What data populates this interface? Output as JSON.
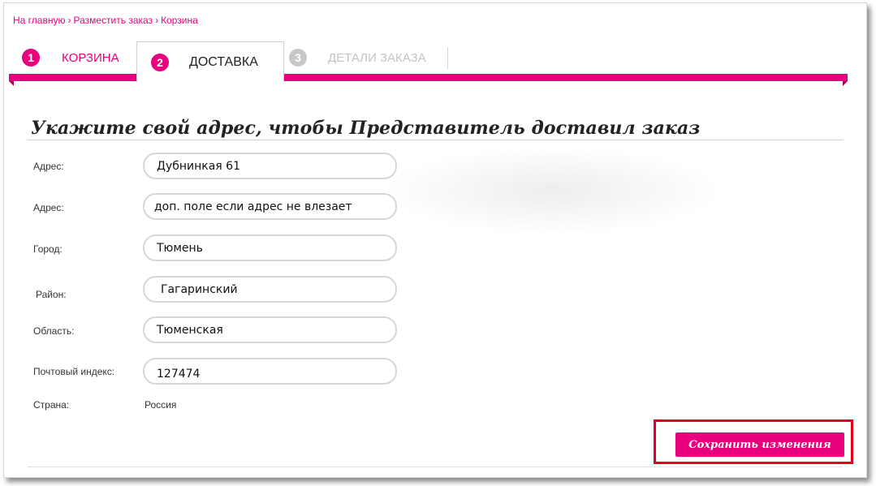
{
  "breadcrumb": {
    "items": [
      "На главную",
      "Разместить заказ",
      "Корзина"
    ],
    "separator": "›"
  },
  "tabs": [
    {
      "number": "1",
      "label": "КОРЗИНА",
      "state": "completed"
    },
    {
      "number": "2",
      "label": "ДОСТАВКА",
      "state": "active"
    },
    {
      "number": "3",
      "label": "ДЕТАЛИ ЗАКАЗА",
      "state": "disabled"
    }
  ],
  "heading": "Укажите свой адрес, чтобы Представитель доставил заказ",
  "form": {
    "address1": {
      "label": "Адрес:",
      "value": "Дубнинкая 61"
    },
    "address2": {
      "label": "Адрес:",
      "value": "доп. поле если адрес не влезает"
    },
    "city": {
      "label": "Город:",
      "value": "Тюмень"
    },
    "district": {
      "label": "Район:",
      "value": "Гагаринский"
    },
    "region": {
      "label": "Область:",
      "value": "Тюменская"
    },
    "postcode": {
      "label": "Почтовый индекс:",
      "value": "127474"
    },
    "country": {
      "label": "Страна:",
      "value": "Россия"
    }
  },
  "save_button": {
    "label": "Сохранить изменения"
  },
  "colors": {
    "accent": "#e8007d",
    "highlight_box": "#e3001b",
    "disabled": "#c8c8c8"
  }
}
